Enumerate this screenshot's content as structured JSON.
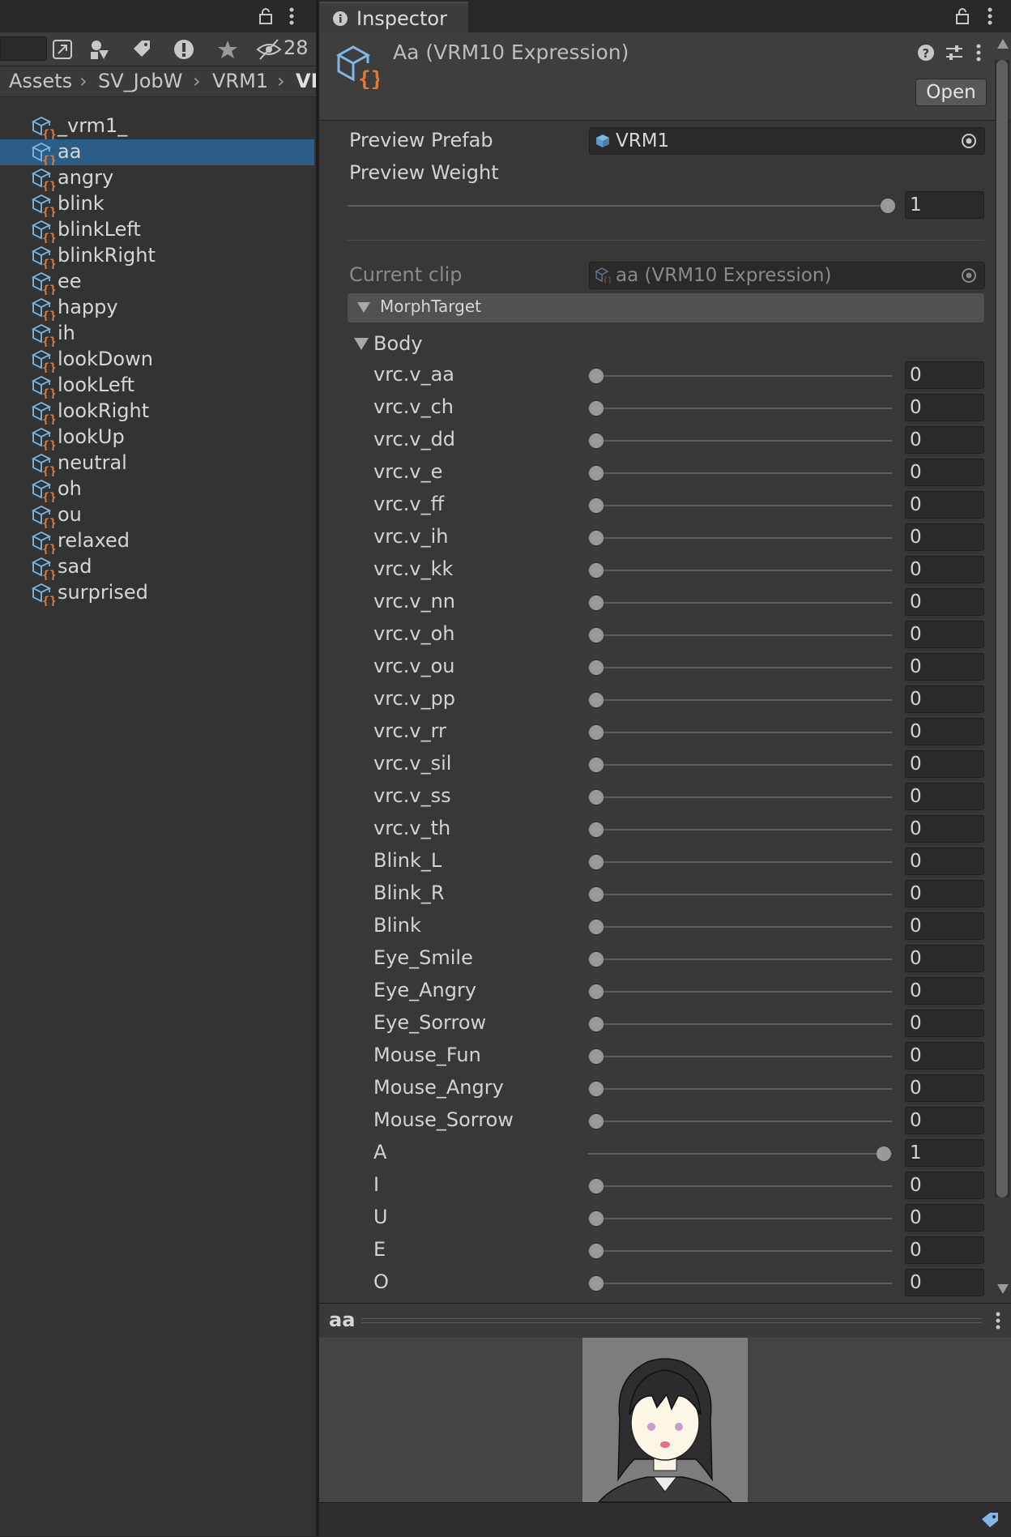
{
  "left_panel": {
    "search_value": "",
    "hidden_count": "28",
    "breadcrumb": [
      "Assets",
      "SV_JobW",
      "VRM1",
      "VI"
    ],
    "assets": [
      {
        "label": "_vrm1_",
        "selected": false
      },
      {
        "label": "aa",
        "selected": true
      },
      {
        "label": "angry",
        "selected": false
      },
      {
        "label": "blink",
        "selected": false
      },
      {
        "label": "blinkLeft",
        "selected": false
      },
      {
        "label": "blinkRight",
        "selected": false
      },
      {
        "label": "ee",
        "selected": false
      },
      {
        "label": "happy",
        "selected": false
      },
      {
        "label": "ih",
        "selected": false
      },
      {
        "label": "lookDown",
        "selected": false
      },
      {
        "label": "lookLeft",
        "selected": false
      },
      {
        "label": "lookRight",
        "selected": false
      },
      {
        "label": "lookUp",
        "selected": false
      },
      {
        "label": "neutral",
        "selected": false
      },
      {
        "label": "oh",
        "selected": false
      },
      {
        "label": "ou",
        "selected": false
      },
      {
        "label": "relaxed",
        "selected": false
      },
      {
        "label": "sad",
        "selected": false
      },
      {
        "label": "surprised",
        "selected": false
      }
    ]
  },
  "inspector": {
    "tab_label": "Inspector",
    "title": "Aa (VRM10 Expression)",
    "open_button": "Open",
    "preview_prefab_label": "Preview Prefab",
    "preview_prefab_value": "VRM1",
    "preview_weight_label": "Preview Weight",
    "preview_weight_value": "1",
    "current_clip_label": "Current clip",
    "current_clip_value": "aa (VRM10 Expression)",
    "morph_section": "MorphTarget",
    "body_label": "Body",
    "morph_targets": [
      {
        "name": "vrc.v_aa",
        "value": "0"
      },
      {
        "name": "vrc.v_ch",
        "value": "0"
      },
      {
        "name": "vrc.v_dd",
        "value": "0"
      },
      {
        "name": "vrc.v_e",
        "value": "0"
      },
      {
        "name": "vrc.v_ff",
        "value": "0"
      },
      {
        "name": "vrc.v_ih",
        "value": "0"
      },
      {
        "name": "vrc.v_kk",
        "value": "0"
      },
      {
        "name": "vrc.v_nn",
        "value": "0"
      },
      {
        "name": "vrc.v_oh",
        "value": "0"
      },
      {
        "name": "vrc.v_ou",
        "value": "0"
      },
      {
        "name": "vrc.v_pp",
        "value": "0"
      },
      {
        "name": "vrc.v_rr",
        "value": "0"
      },
      {
        "name": "vrc.v_sil",
        "value": "0"
      },
      {
        "name": "vrc.v_ss",
        "value": "0"
      },
      {
        "name": "vrc.v_th",
        "value": "0"
      },
      {
        "name": "Blink_L",
        "value": "0"
      },
      {
        "name": "Blink_R",
        "value": "0"
      },
      {
        "name": "Blink",
        "value": "0"
      },
      {
        "name": "Eye_Smile",
        "value": "0"
      },
      {
        "name": "Eye_Angry",
        "value": "0"
      },
      {
        "name": "Eye_Sorrow",
        "value": "0"
      },
      {
        "name": "Mouse_Fun",
        "value": "0"
      },
      {
        "name": "Mouse_Angry",
        "value": "0"
      },
      {
        "name": "Mouse_Sorrow",
        "value": "0"
      },
      {
        "name": "A",
        "value": "1"
      },
      {
        "name": "I",
        "value": "0"
      },
      {
        "name": "U",
        "value": "0"
      },
      {
        "name": "E",
        "value": "0"
      },
      {
        "name": "O",
        "value": "0"
      }
    ],
    "preview_title": "aa"
  },
  "colors": {
    "selection": "#2c5d87",
    "asset_icon_blue": "#7fb8e6",
    "asset_icon_orange": "#e07a3a"
  }
}
